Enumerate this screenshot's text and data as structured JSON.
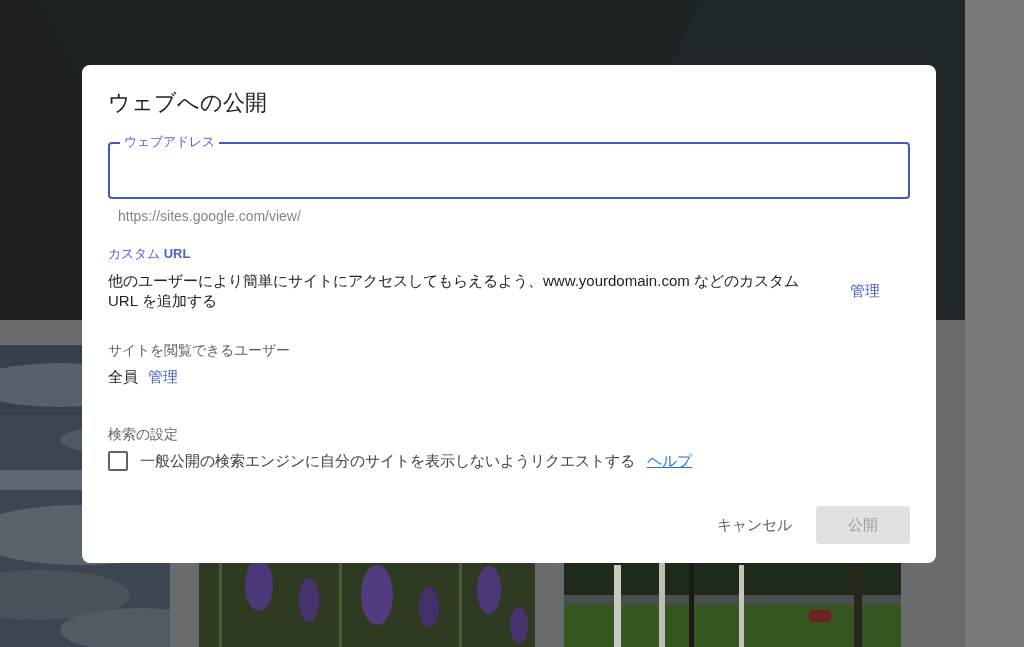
{
  "dialog": {
    "title": "ウェブへの公開",
    "address_field": {
      "label": "ウェブアドレス",
      "focused": true
    },
    "helper_text": "https://sites.google.com/view/",
    "custom_url": {
      "heading": "カスタム **URL**",
      "description": "他のユーザーにより簡単にサイトにアクセスしてもらえるよう、www.yourdomain.com などのカスタム URL を追加する",
      "manage_link": "管理"
    },
    "viewers": {
      "heading": "サイトを閲覧できるユーザー",
      "value": "全員",
      "manage_link": "管理"
    },
    "search_settings": {
      "heading": "検索の設定",
      "checkbox": {
        "label": "一般公開の検索エンジンに自分のサイトを表示しないようリクエストする",
        "checked": false
      },
      "help_link": "ヘルプ"
    },
    "buttons": [
      {
        "label": "キャンセル",
        "kind": "text",
        "disabled": false
      },
      {
        "label": "公開",
        "kind": "filled",
        "disabled": true
      }
    ]
  }
}
